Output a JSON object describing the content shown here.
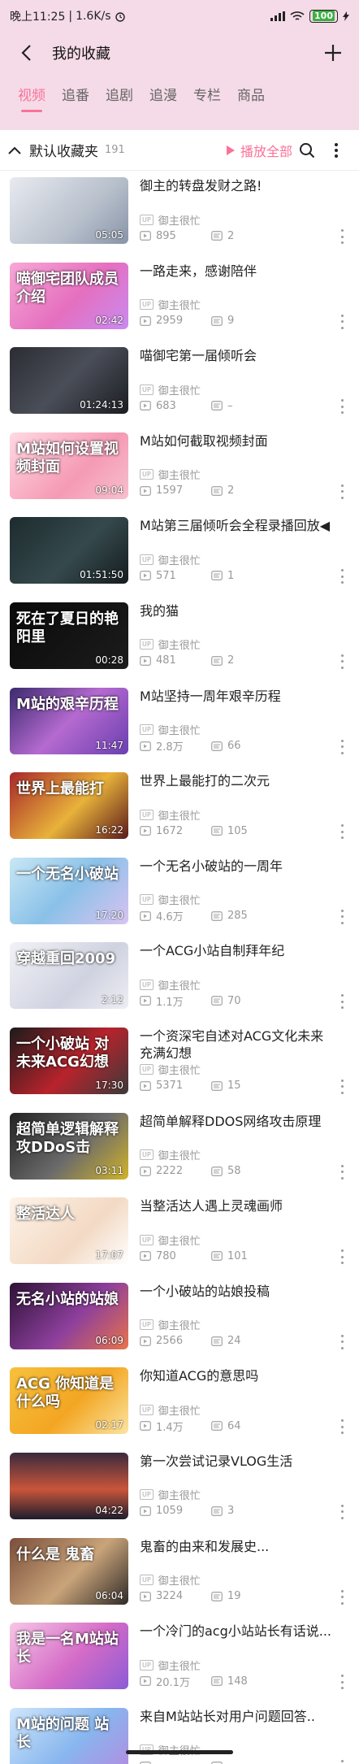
{
  "status": {
    "time": "晚上11:25",
    "speed": "1.6K/s",
    "battery": "100"
  },
  "header": {
    "title": "我的收藏"
  },
  "tabs": [
    "视频",
    "追番",
    "追剧",
    "追漫",
    "专栏",
    "商品"
  ],
  "toolbar": {
    "folder_name": "默认收藏夹",
    "count": "191",
    "play_all": "播放全部"
  },
  "colors": {
    "accent": "#fb7299",
    "header_bg": "#f5dbe7"
  },
  "videos": [
    {
      "title": "御主的转盘发财之路!",
      "up": "御主很忙",
      "views": "895",
      "danmaku": "2",
      "duration": "05:05",
      "thumb_text": "",
      "bg": "linear-gradient(135deg,#e8eaf0,#b8c0cc 60%,#8894a8)"
    },
    {
      "title": "一路走来，感谢陪伴",
      "up": "御主很忙",
      "views": "2959",
      "danmaku": "9",
      "duration": "02:42",
      "thumb_text": "喵御宅团队成员介绍",
      "bg": "linear-gradient(135deg,#f7a8d6,#e56fbf 55%,#c88bf0)"
    },
    {
      "title": "喵御宅第一届倾听会",
      "up": "御主很忙",
      "views": "683",
      "danmaku": "–",
      "duration": "01:24:13",
      "thumb_text": "",
      "bg": "linear-gradient(135deg,#2b2d33,#4a4e58 50%,#1c1d22)"
    },
    {
      "title": "M站如何截取视频封面",
      "up": "御主很忙",
      "views": "1597",
      "danmaku": "2",
      "duration": "09:04",
      "thumb_text": "M站如何设置视频封面",
      "bg": "linear-gradient(135deg,#ffd9e3,#f59ab4 60%,#f7c0cf)"
    },
    {
      "title": "M站第三届倾听会全程录播回放◀",
      "up": "御主很忙",
      "views": "571",
      "danmaku": "1",
      "duration": "01:51:50",
      "thumb_text": "",
      "bg": "linear-gradient(135deg,#1d2b2e,#35494d 55%,#151c1e)"
    },
    {
      "title": "我的猫",
      "up": "御主很忙",
      "views": "481",
      "danmaku": "2",
      "duration": "00:28",
      "thumb_text": "死在了夏日的艳阳里",
      "bg": "linear-gradient(135deg,#0a0a0a,#1c1c1c)"
    },
    {
      "title": "M站坚持一周年艰辛历程",
      "up": "御主很忙",
      "views": "2.8万",
      "danmaku": "66",
      "duration": "11:47",
      "thumb_text": "M站的艰辛历程",
      "bg": "linear-gradient(135deg,#3b2a6e,#b56ad0 50%,#6a3fb0)"
    },
    {
      "title": "世界上最能打的二次元",
      "up": "御主很忙",
      "views": "1672",
      "danmaku": "105",
      "duration": "16:22",
      "thumb_text": "世界上最能打",
      "bg": "linear-gradient(135deg,#a7262a,#e8b23a 55%,#5a1a1a)"
    },
    {
      "title": "一个无名小破站的一周年",
      "up": "御主很忙",
      "views": "4.6万",
      "danmaku": "285",
      "duration": "17:20",
      "thumb_text": "一个无名小破站",
      "bg": "linear-gradient(135deg,#c9e7f5,#8ac1e8 50%,#d8c3f0)"
    },
    {
      "title": "一个ACG小站自制拜年纪",
      "up": "御主很忙",
      "views": "1.1万",
      "danmaku": "70",
      "duration": "2:12",
      "thumb_text": "穿越重回2009",
      "bg": "linear-gradient(135deg,#f2f2f6,#cfd2e0 60%,#eeeef4)"
    },
    {
      "title": "一个资深宅自述对ACG文化未来充满幻想",
      "up": "御主很忙",
      "views": "5371",
      "danmaku": "15",
      "duration": "17:30",
      "thumb_text": "一个小破站 对未来ACG幻想",
      "bg": "linear-gradient(135deg,#1b1b1b,#b8232c 55%,#3a3a3a)"
    },
    {
      "title": "超简单解释DDOS网络攻击原理",
      "up": "御主很忙",
      "views": "2222",
      "danmaku": "58",
      "duration": "03:11",
      "thumb_text": "超简单逻辑解释 攻DDoS击",
      "bg": "linear-gradient(135deg,#222,#6b6b6b 55%,#d1b32a)"
    },
    {
      "title": "当整活达人遇上灵魂画师",
      "up": "御主很忙",
      "views": "780",
      "danmaku": "101",
      "duration": "17:07",
      "thumb_text": "整活达人",
      "bg": "linear-gradient(135deg,#fdf3e8,#f3d9c4 60%,#fff)"
    },
    {
      "title": "一个小破站的站娘投稿",
      "up": "御主很忙",
      "views": "2566",
      "danmaku": "24",
      "duration": "06:09",
      "thumb_text": "无名小站的站娘",
      "bg": "linear-gradient(135deg,#2d1236,#8d3f9c 55%,#e8734a)"
    },
    {
      "title": "你知道ACG的意思吗",
      "up": "御主很忙",
      "views": "1.4万",
      "danmaku": "64",
      "duration": "02:17",
      "thumb_text": "ACG 你知道是什么吗",
      "bg": "linear-gradient(135deg,#f6c13d,#f3a623 55%,#fbe4a0)"
    },
    {
      "title": "第一次尝试记录VLOG生活",
      "up": "御主很忙",
      "views": "1059",
      "danmaku": "3",
      "duration": "04:22",
      "thumb_text": "",
      "bg": "linear-gradient(180deg,#3b2a3d,#c9553a 55%,#1d1d2c)"
    },
    {
      "title": "鬼畜的由来和发展史...",
      "up": "御主很忙",
      "views": "3224",
      "danmaku": "19",
      "duration": "06:04",
      "thumb_text": "什么是 鬼畜",
      "bg": "linear-gradient(135deg,#7a4e3a,#c9a47a 55%,#2e2a28)"
    },
    {
      "title": "一个冷门的acg小站站长有话说...",
      "up": "御主很忙",
      "views": "20.1万",
      "danmaku": "148",
      "duration": "",
      "thumb_text": "我是一名M站站长",
      "bg": "linear-gradient(135deg,#f7c7e6,#d46bc7 55%,#8c5bd6)"
    },
    {
      "title": "来自M站站长对用户问题回答..",
      "up": "御主很忙",
      "views": "",
      "danmaku": "",
      "duration": "",
      "thumb_text": "M站的问题 站长",
      "bg": "linear-gradient(135deg,#cfe6fb,#88b6ee 55%,#b38be0)"
    }
  ]
}
